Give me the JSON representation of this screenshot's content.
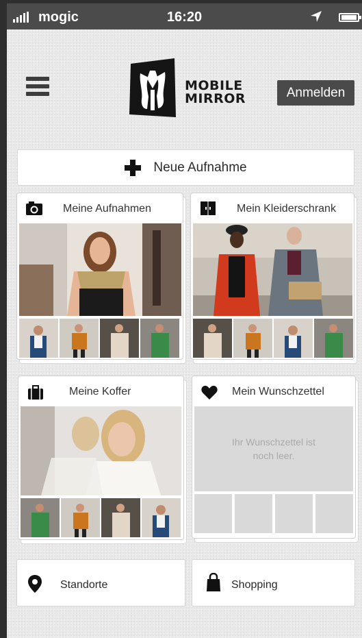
{
  "status_bar": {
    "carrier": "mogic",
    "time": "16:20",
    "icons": [
      "signal-bars-icon",
      "location-arrow-icon",
      "battery-icon"
    ]
  },
  "header": {
    "menu_icon": "hamburger-menu-icon",
    "logo_line1": "MOBILE",
    "logo_line2": "MIRROR",
    "login_label": "Anmelden"
  },
  "new_capture": {
    "label": "Neue Aufnahme",
    "icon": "plus-icon"
  },
  "cards": {
    "captures": {
      "title": "Meine Aufnahmen",
      "icon": "camera-icon"
    },
    "wardrobe": {
      "title": "Mein Kleiderschrank",
      "icon": "wardrobe-icon"
    },
    "suitcase": {
      "title": "Meine Koffer",
      "icon": "suitcase-icon"
    },
    "wishlist": {
      "title": "Mein Wunschzettel",
      "icon": "heart-icon",
      "empty_text": "Ihr Wunschzettel ist noch leer."
    }
  },
  "bottom": {
    "locations": {
      "label": "Standorte",
      "icon": "map-pin-icon"
    },
    "shopping": {
      "label": "Shopping",
      "icon": "shopping-bag-icon"
    }
  },
  "colors": {
    "status_bar": "#4b4b4b",
    "login_button": "#4a4a4a",
    "background": "#e9e9e9",
    "placeholder": "#d9d9d9"
  }
}
